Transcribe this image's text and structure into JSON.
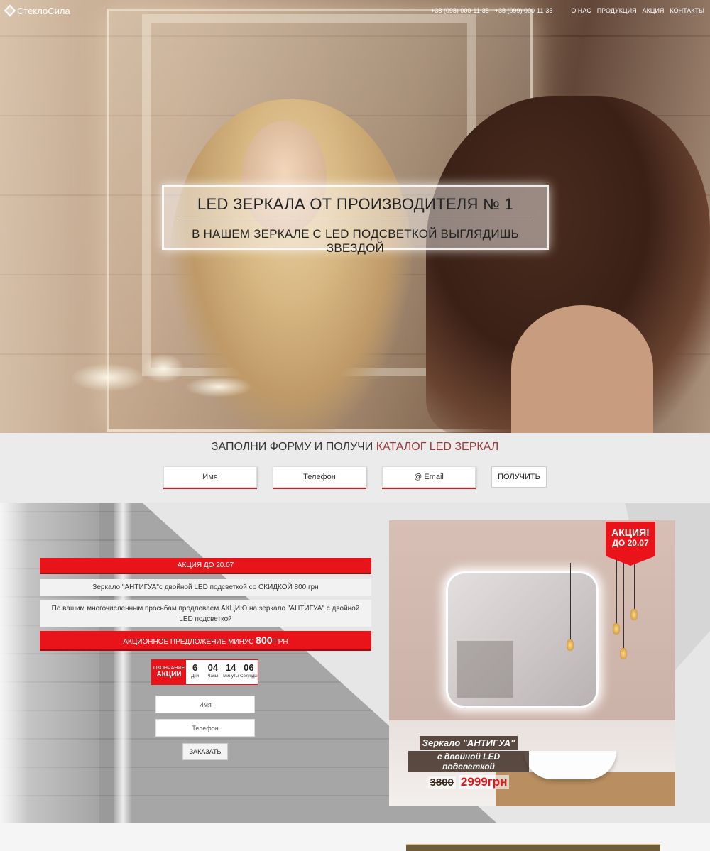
{
  "header": {
    "logo_text": "СтеклоСила",
    "phones": [
      "+38 (098) 000-11-35",
      "+38 (099) 000-11-35"
    ],
    "nav": [
      "О НАС",
      "ПРОДУКЦИЯ",
      "АКЦИЯ",
      "КОНТАКТЫ"
    ]
  },
  "hero": {
    "title": "LED ЗЕРКАЛА ОТ ПРОИЗВОДИТЕЛЯ № 1",
    "subtitle": "В НАШЕМ ЗЕРКАЛЕ С LED ПОДСВЕТКОЙ ВЫГЛЯДИШЬ ЗВЕЗДОЙ"
  },
  "catalog": {
    "title_prefix": "ЗАПОЛНИ ФОРМУ И ПОЛУЧИ ",
    "title_accent": "КАТАЛОГ LED ЗЕРКАЛ",
    "name_placeholder": "Имя",
    "phone_placeholder": "Телефон",
    "email_placeholder": "@ Email",
    "submit_label": "ПОЛУЧИТЬ"
  },
  "promo": {
    "deadline": "АКЦИЯ ДО 20.07",
    "line1": "Зеркало \"АНТИГУА\"с двойной LED подсветкой со СКИДКОЙ 800 грн",
    "line2": "По вашим многочисленным просьбам продлеваем АКЦИЮ на зеркало \"АНТИГУА\" с двойной LED подсветкой",
    "offer_text": "АКЦИОННОЕ ПРЕДЛОЖЕНИЕ МИНУС ",
    "offer_amount": "800",
    "offer_unit": " ГРН",
    "countdown": {
      "label_small": "ОКОНЧАНИЕ",
      "label_big": "АКЦИИ",
      "days": "6",
      "days_label": "Дни",
      "hours": "04",
      "hours_label": "Часы",
      "minutes": "14",
      "minutes_label": "Минуты",
      "seconds": "06",
      "seconds_label": "Секунды"
    },
    "name_placeholder": "Имя",
    "phone_placeholder": "Телефон",
    "order_label": "ЗАКАЗАТЬ"
  },
  "product": {
    "badge_line1": "АКЦИЯ!",
    "badge_line2": "ДО 20.07",
    "caption_line1": "Зеркало \"АНТИГУА\"",
    "caption_line2": "с двойной LED подсветкой",
    "old_price": "3800",
    "new_price": "2999грн"
  },
  "colors": {
    "accent_red": "#e8141a",
    "accent_wine": "#9b3a3a"
  }
}
